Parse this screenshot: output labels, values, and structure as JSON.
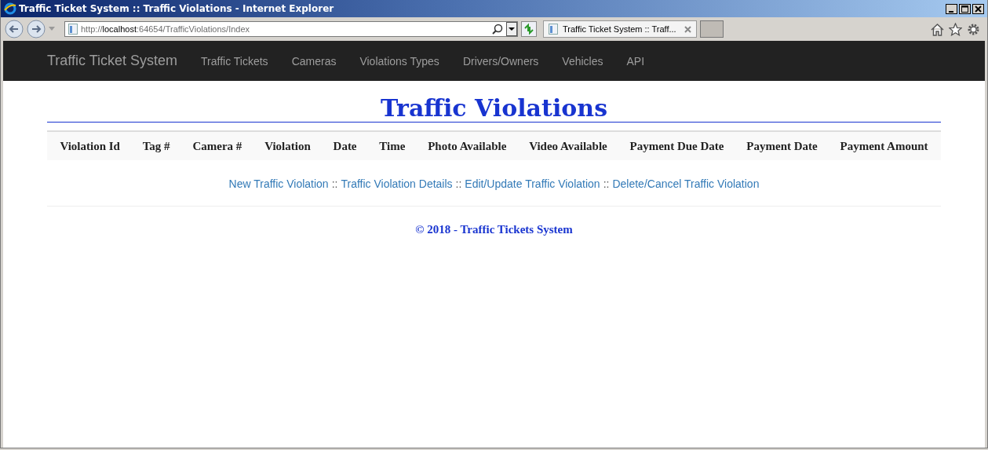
{
  "window": {
    "title": "Traffic Ticket System :: Traffic Violations - Internet Explorer"
  },
  "address_bar": {
    "prefix": "http://",
    "host": "localhost",
    "rest": ":64654/TrafficViolations/Index"
  },
  "tabs": [
    {
      "label": "Traffic Ticket System :: Traff...",
      "selected": true
    }
  ],
  "navbar": {
    "brand": "Traffic Ticket System",
    "items": [
      {
        "label": "Traffic Tickets"
      },
      {
        "label": "Cameras"
      },
      {
        "label": "Violations Types"
      },
      {
        "label": "Drivers/Owners"
      },
      {
        "label": "Vehicles"
      },
      {
        "label": "API"
      }
    ]
  },
  "page_title": "Traffic Violations",
  "table": {
    "columns": [
      "Violation Id",
      "Tag #",
      "Camera #",
      "Violation",
      "Date",
      "Time",
      "Photo Available",
      "Video Available",
      "Payment Due Date",
      "Payment Date",
      "Payment Amount"
    ]
  },
  "actions": [
    {
      "kind": "link",
      "text": "New Traffic Violation"
    },
    {
      "kind": "separator",
      "text": "::"
    },
    {
      "kind": "link",
      "text": "Traffic Violation Details"
    },
    {
      "kind": "separator",
      "text": "::"
    },
    {
      "kind": "link",
      "text": "Edit/Update Traffic Violation"
    },
    {
      "kind": "separator",
      "text": "::"
    },
    {
      "kind": "link",
      "text": "Delete/Cancel Traffic Violation"
    }
  ],
  "footer": "© 2018 - Traffic Tickets System"
}
